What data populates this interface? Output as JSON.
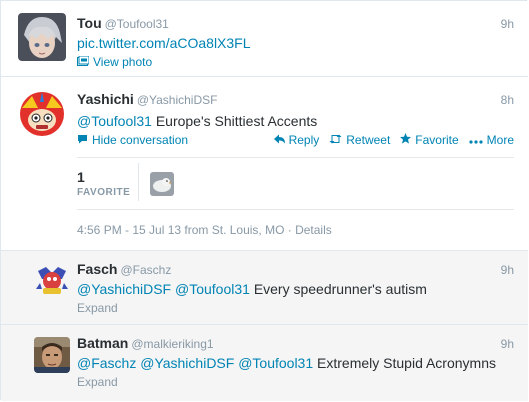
{
  "tweets": [
    {
      "name": "Tou",
      "handle": "@Toufool31",
      "time": "9h",
      "text_link": "pic.twitter.com/aCOa8lX3FL",
      "view_photo": "View photo"
    },
    {
      "name": "Yashichi",
      "handle": "@YashichiDSF",
      "time": "8h",
      "mention": "@Toufool31",
      "text": "Europe's Shittiest Accents",
      "hide_conversation": "Hide conversation",
      "actions": {
        "reply": "Reply",
        "retweet": "Retweet",
        "favorite": "Favorite",
        "more": "More"
      },
      "fav_count": "1",
      "fav_label": "FAVORITE",
      "timestamp": "4:56 PM - 15 Jul 13 from St. Louis, MO · Details"
    },
    {
      "name": "Fasch",
      "handle": "@Faschz",
      "time": "9h",
      "mentions": "@YashichiDSF @Toufool31",
      "text": "Every speedrunner's autism",
      "expand": "Expand"
    },
    {
      "name": "Batman",
      "handle": "@malkieriking1",
      "time": "9h",
      "mentions": "@Faschz @YashichiDSF @Toufool31",
      "text": "Extremely Stupid Acronymns",
      "expand": "Expand"
    }
  ],
  "icons": {
    "photo": "photo-icon",
    "conversation": "conversation-icon",
    "reply": "reply-arrow-icon",
    "retweet": "retweet-icon",
    "favorite": "star-icon",
    "more": "dots-icon"
  },
  "colors": {
    "link": "#0084b4",
    "muted": "#8899a6",
    "text": "#292f33"
  }
}
